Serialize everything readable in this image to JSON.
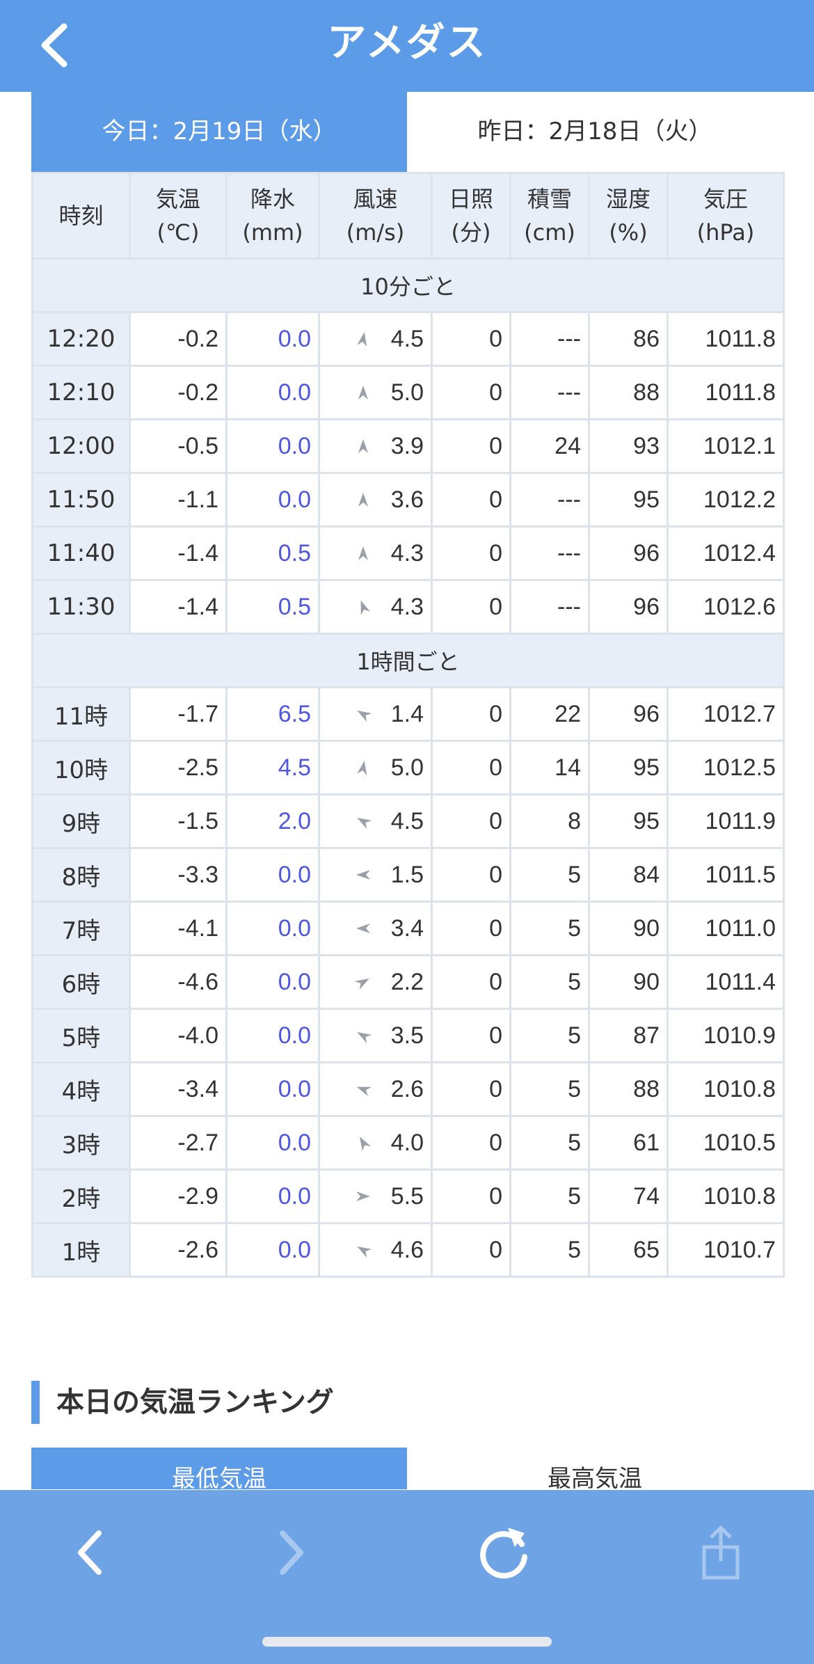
{
  "header": {
    "title": "アメダス",
    "back_icon": "chevron-left-icon"
  },
  "tabs": {
    "today": "今日：2月19日（水）",
    "yesterday": "昨日：2月18日（火）"
  },
  "table": {
    "headers": [
      {
        "label": "時刻",
        "unit": ""
      },
      {
        "label": "気温",
        "unit": "(℃)"
      },
      {
        "label": "降水",
        "unit": "(mm)"
      },
      {
        "label": "風速",
        "unit": "(m/s)"
      },
      {
        "label": "日照",
        "unit": "(分)"
      },
      {
        "label": "積雪",
        "unit": "(cm)"
      },
      {
        "label": "湿度",
        "unit": "(%)"
      },
      {
        "label": "気圧",
        "unit": "(hPa)"
      }
    ],
    "sections": [
      {
        "label": "10分ごと",
        "rows": [
          {
            "time": "12:20",
            "temp": "-0.2",
            "precip": "0.0",
            "wind_dir_deg": 10,
            "wind": "4.5",
            "sun": "0",
            "snow": "---",
            "humidity": "86",
            "pressure": "1011.8"
          },
          {
            "time": "12:10",
            "temp": "-0.2",
            "precip": "0.0",
            "wind_dir_deg": 0,
            "wind": "5.0",
            "sun": "0",
            "snow": "---",
            "humidity": "88",
            "pressure": "1011.8"
          },
          {
            "time": "12:00",
            "temp": "-0.5",
            "precip": "0.0",
            "wind_dir_deg": 0,
            "wind": "3.9",
            "sun": "0",
            "snow": "24",
            "humidity": "93",
            "pressure": "1012.1"
          },
          {
            "time": "11:50",
            "temp": "-1.1",
            "precip": "0.0",
            "wind_dir_deg": 0,
            "wind": "3.6",
            "sun": "0",
            "snow": "---",
            "humidity": "95",
            "pressure": "1012.2"
          },
          {
            "time": "11:40",
            "temp": "-1.4",
            "precip": "0.5",
            "wind_dir_deg": 0,
            "wind": "4.3",
            "sun": "0",
            "snow": "---",
            "humidity": "96",
            "pressure": "1012.4"
          },
          {
            "time": "11:30",
            "temp": "-1.4",
            "precip": "0.5",
            "wind_dir_deg": 340,
            "wind": "4.3",
            "sun": "0",
            "snow": "---",
            "humidity": "96",
            "pressure": "1012.6"
          }
        ]
      },
      {
        "label": "1時間ごと",
        "rows": [
          {
            "time": "11時",
            "temp": "-1.7",
            "precip": "6.5",
            "wind_dir_deg": 300,
            "wind": "1.4",
            "sun": "0",
            "snow": "22",
            "humidity": "96",
            "pressure": "1012.7"
          },
          {
            "time": "10時",
            "temp": "-2.5",
            "precip": "4.5",
            "wind_dir_deg": 10,
            "wind": "5.0",
            "sun": "0",
            "snow": "14",
            "humidity": "95",
            "pressure": "1012.5"
          },
          {
            "time": "9時",
            "temp": "-1.5",
            "precip": "2.0",
            "wind_dir_deg": 300,
            "wind": "4.5",
            "sun": "0",
            "snow": "8",
            "humidity": "95",
            "pressure": "1011.9"
          },
          {
            "time": "8時",
            "temp": "-3.3",
            "precip": "0.0",
            "wind_dir_deg": 270,
            "wind": "1.5",
            "sun": "0",
            "snow": "5",
            "humidity": "84",
            "pressure": "1011.5"
          },
          {
            "time": "7時",
            "temp": "-4.1",
            "precip": "0.0",
            "wind_dir_deg": 270,
            "wind": "3.4",
            "sun": "0",
            "snow": "5",
            "humidity": "90",
            "pressure": "1011.0"
          },
          {
            "time": "6時",
            "temp": "-4.6",
            "precip": "0.0",
            "wind_dir_deg": 60,
            "wind": "2.2",
            "sun": "0",
            "snow": "5",
            "humidity": "90",
            "pressure": "1011.4"
          },
          {
            "time": "5時",
            "temp": "-4.0",
            "precip": "0.0",
            "wind_dir_deg": 300,
            "wind": "3.5",
            "sun": "0",
            "snow": "5",
            "humidity": "87",
            "pressure": "1010.9"
          },
          {
            "time": "4時",
            "temp": "-3.4",
            "precip": "0.0",
            "wind_dir_deg": 290,
            "wind": "2.6",
            "sun": "0",
            "snow": "5",
            "humidity": "88",
            "pressure": "1010.8"
          },
          {
            "time": "3時",
            "temp": "-2.7",
            "precip": "0.0",
            "wind_dir_deg": 330,
            "wind": "4.0",
            "sun": "0",
            "snow": "5",
            "humidity": "61",
            "pressure": "1010.5"
          },
          {
            "time": "2時",
            "temp": "-2.9",
            "precip": "0.0",
            "wind_dir_deg": 90,
            "wind": "5.5",
            "sun": "0",
            "snow": "5",
            "humidity": "74",
            "pressure": "1010.8"
          },
          {
            "time": "1時",
            "temp": "-2.6",
            "precip": "0.0",
            "wind_dir_deg": 300,
            "wind": "4.6",
            "sun": "0",
            "snow": "5",
            "humidity": "65",
            "pressure": "1010.7"
          }
        ]
      }
    ]
  },
  "ranking": {
    "title": "本日の気温ランキング",
    "tab_low": "最低気温",
    "tab_high": "最高気温"
  },
  "toolbar": {
    "back_icon": "chevron-left-icon",
    "forward_icon": "chevron-right-icon",
    "reload_icon": "reload-icon",
    "share_icon": "share-icon"
  },
  "colors": {
    "accent": "#5b9be8",
    "toolbar": "#6ea4e6",
    "precip_text": "#4f57e0",
    "header_cell": "#e8eef7",
    "grid": "#dde3ea"
  }
}
